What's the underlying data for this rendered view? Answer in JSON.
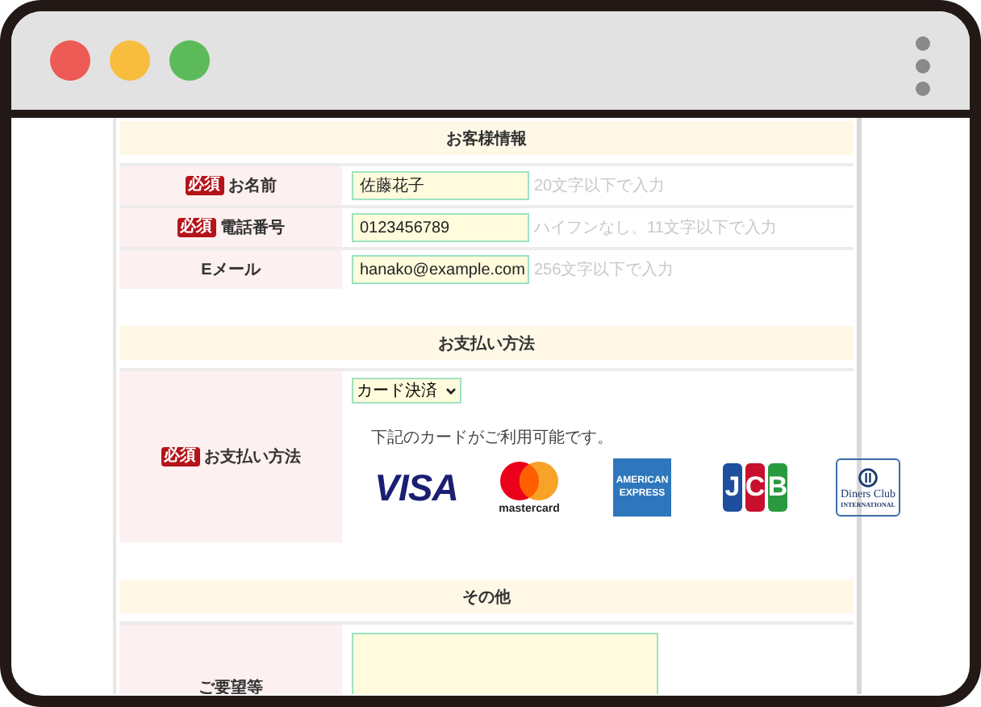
{
  "window": {
    "controls": [
      {
        "color": "#ee5a55"
      },
      {
        "color": "#f8bd3f"
      },
      {
        "color": "#5cba5a"
      }
    ]
  },
  "sections": [
    {
      "title": "お客様情報",
      "rows": [
        {
          "kind": "text",
          "label": "お名前",
          "required": true,
          "badge": "必須",
          "value": "佐藤花子",
          "hint": "20文字以下で入力"
        },
        {
          "kind": "text",
          "label": "電話番号",
          "required": true,
          "badge": "必須",
          "value": "0123456789",
          "hint": "ハイフンなし、11文字以下で入力"
        },
        {
          "kind": "text",
          "label": "Eメール",
          "required": false,
          "value": "hanako@example.com",
          "hint": "256文字以下で入力"
        }
      ]
    },
    {
      "title": "お支払い方法",
      "rows": [
        {
          "kind": "select",
          "label": "お支払い方法",
          "required": true,
          "badge": "必須",
          "value": "カード決済",
          "note": "下記のカードがご利用可能です。",
          "cards": [
            {
              "kind": "visa",
              "lines": [
                "VISA"
              ]
            },
            {
              "kind": "mastercard",
              "lines": [
                "mastercard"
              ]
            },
            {
              "kind": "amex",
              "lines": [
                "AMERICAN",
                "EXPRESS"
              ]
            },
            {
              "kind": "jcb",
              "lines": [
                "J",
                "C",
                "B"
              ]
            },
            {
              "kind": "diners",
              "lines": [
                "Diners Club",
                "INTERNATIONAL"
              ]
            }
          ]
        }
      ]
    },
    {
      "title": "その他",
      "rows": [
        {
          "kind": "textarea",
          "label": "ご要望等",
          "required": false,
          "value": ""
        }
      ]
    }
  ]
}
